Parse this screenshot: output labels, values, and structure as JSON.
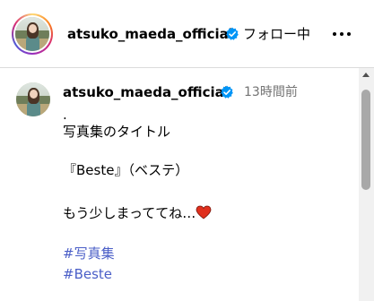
{
  "header": {
    "username": "atsuko_maeda_official",
    "follow_status": "フォロー中",
    "more_icon": "more-horizontal-icon"
  },
  "post": {
    "username": "atsuko_maeda_official",
    "time": "13時間前",
    "caption": {
      "line1": ".",
      "line2": "写真集のタイトル",
      "line3": "『Beste』（ベステ）",
      "line4": "もう少しまっててね…",
      "hashtag1": "#写真集",
      "hashtag2": "#Beste"
    }
  },
  "colors": {
    "verified_blue": "#0095f6",
    "hashtag_blue": "#4a5ec7",
    "timestamp_gray": "#737373",
    "heart_red": "#e0301e"
  },
  "icons": {
    "verified": "verified-badge-icon",
    "heart": "red-heart-emoji-icon"
  }
}
